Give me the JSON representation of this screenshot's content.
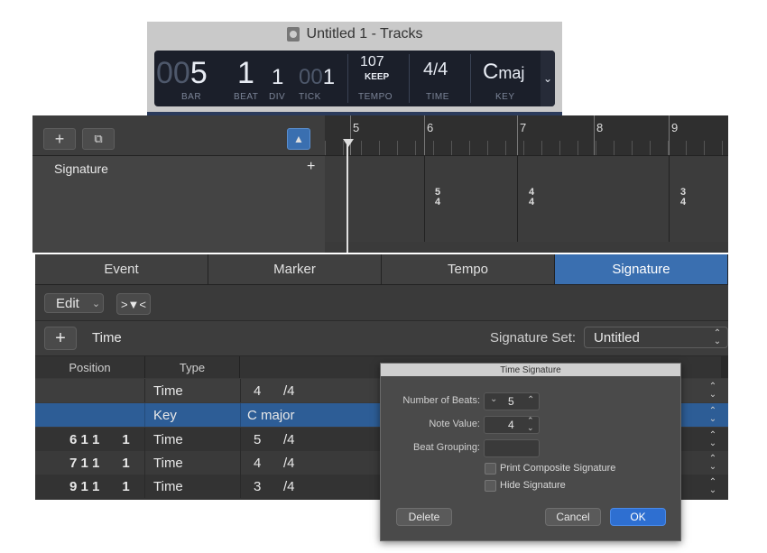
{
  "window": {
    "title": "Untitled 1 - Tracks"
  },
  "lcd": {
    "bar_dim": "00",
    "bar": "5",
    "beat": "1",
    "div": "1",
    "tick_dim": "00",
    "tick": "1",
    "tempo": "107",
    "tempo_mode": "KEEP",
    "time_num": "4",
    "time_den": "4",
    "key": "C",
    "key_suffix": "maj",
    "labels": {
      "bar": "BAR",
      "beat": "BEAT",
      "div": "DIV",
      "tick": "TICK",
      "tempo": "TEMPO",
      "time": "TIME",
      "key": "KEY"
    }
  },
  "tracks": {
    "track_name": "Signature",
    "ruler": [
      "5",
      "6",
      "7",
      "8",
      "9"
    ],
    "signatures": [
      {
        "num": "5",
        "den": "4"
      },
      {
        "num": "4",
        "den": "4"
      },
      {
        "num": "3",
        "den": "4"
      }
    ]
  },
  "editor": {
    "tabs": [
      "Event",
      "Marker",
      "Tempo",
      "Signature"
    ],
    "active_tab": "Signature",
    "edit_label": "Edit",
    "add_type": "Time",
    "signature_set_label": "Signature Set:",
    "signature_set_value": "Untitled",
    "columns": {
      "position": "Position",
      "type": "Type"
    },
    "rows": [
      {
        "position": "",
        "type": "Time",
        "value": "4",
        "unit": "/4"
      },
      {
        "position": "",
        "type": "Key",
        "value": "C major",
        "unit": ""
      },
      {
        "position": "6 1 1      1",
        "type": "Time",
        "value": "5",
        "unit": "/4"
      },
      {
        "position": "7 1 1      1",
        "type": "Time",
        "value": "4",
        "unit": "/4"
      },
      {
        "position": "9 1 1      1",
        "type": "Time",
        "value": "3",
        "unit": "/4"
      }
    ]
  },
  "dialog": {
    "title": "Time Signature",
    "beats_label": "Number of Beats:",
    "beats_value": "5",
    "note_label": "Note Value:",
    "note_value": "4",
    "grouping_label": "Beat Grouping:",
    "grouping_value": "",
    "composite_label": "Print Composite Signature",
    "hide_label": "Hide Signature",
    "delete_label": "Delete",
    "cancel_label": "Cancel",
    "ok_label": "OK"
  },
  "colors": {
    "accent": "#3a6fb0",
    "lcd_bg": "#1b1f2a"
  }
}
